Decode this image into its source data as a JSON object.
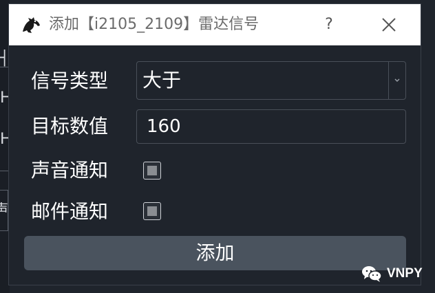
{
  "window": {
    "title": "添加【i2105_2109】雷达信号",
    "help_label": "?",
    "icons": {
      "app": "horse-logo-icon",
      "close": "close-icon"
    }
  },
  "form": {
    "signal_type_label": "信号类型",
    "signal_type_value": "大于",
    "target_value_label": "目标数值",
    "target_value": "160",
    "sound_notify_label": "声音通知",
    "sound_notify_checked": true,
    "email_notify_label": "邮件通知",
    "email_notify_checked": true
  },
  "actions": {
    "add_label": "添加"
  },
  "background": {
    "fragment_text": "声"
  },
  "watermark": {
    "text": "VNPY"
  },
  "colors": {
    "dialog_bg": "#1f242c",
    "titlebar_bg": "#ffffff",
    "button_bg": "#4a535e",
    "text": "#ffffff"
  }
}
